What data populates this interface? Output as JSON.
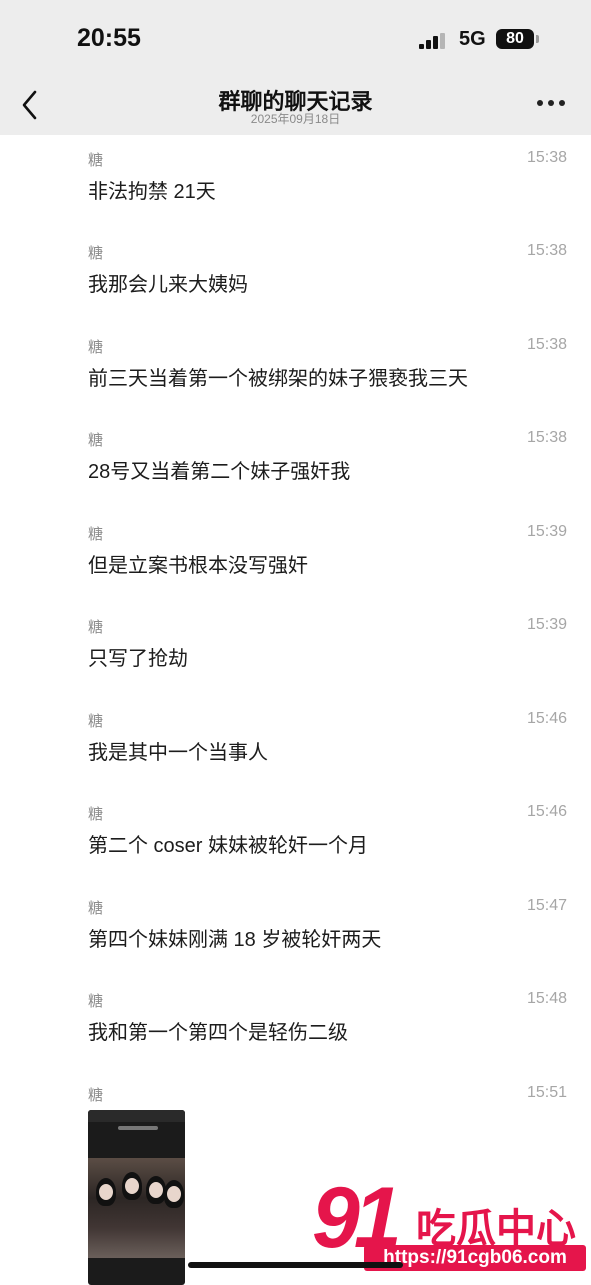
{
  "status_bar": {
    "time": "20:55",
    "network": "5G",
    "battery": "80"
  },
  "header": {
    "title": "群聊的聊天记录",
    "subtitle": "2025年09月18日"
  },
  "messages": [
    {
      "sender": "糖",
      "time": "15:38",
      "text": "非法拘禁 21天"
    },
    {
      "sender": "糖",
      "time": "15:38",
      "text": "我那会儿来大姨妈"
    },
    {
      "sender": "糖",
      "time": "15:38",
      "text": "前三天当着第一个被绑架的妹子猥亵我三天"
    },
    {
      "sender": "糖",
      "time": "15:38",
      "text": "28号又当着第二个妹子强奸我"
    },
    {
      "sender": "糖",
      "time": "15:39",
      "text": "但是立案书根本没写强奸"
    },
    {
      "sender": "糖",
      "time": "15:39",
      "text": "只写了抢劫"
    },
    {
      "sender": "糖",
      "time": "15:46",
      "text": "我是其中一个当事人"
    },
    {
      "sender": "糖",
      "time": "15:46",
      "text": "第二个 coser 妹妹被轮奸一个月"
    },
    {
      "sender": "糖",
      "time": "15:47",
      "text": "第四个妹妹刚满 18 岁被轮奸两天"
    },
    {
      "sender": "糖",
      "time": "15:48",
      "text": "我和第一个第四个是轻伤二级"
    },
    {
      "sender": "糖",
      "time": "15:51",
      "text": ""
    }
  ],
  "watermark": {
    "logo_number": "91",
    "name": "吃瓜中心",
    "url": "https://91cgb06.com"
  },
  "icons": [
    "back-chevron-icon",
    "more-dots-icon",
    "signal-icon",
    "battery-icon"
  ],
  "colors": {
    "header_bg": "#ededed",
    "watermark_red": "#e5154b"
  }
}
